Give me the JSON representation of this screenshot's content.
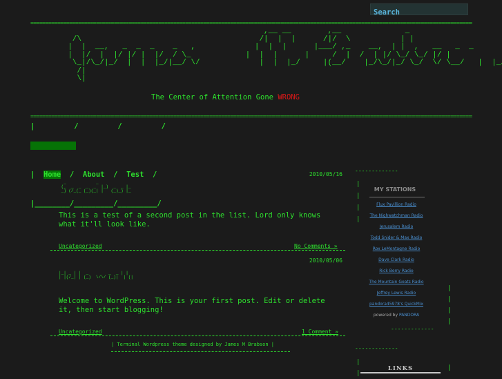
{
  "search": {
    "label": "Search"
  },
  "header": {
    "rule": "==========================================================================================================================================================",
    "logo_ascii": "                                             ,__ __        ,__              _\n   /\\                                       /|  |  |      /|/  \\           | |\n  |  |  __,   _  _  _    _   ,             |  |  |      |___/ ,_    __,  | |  ,   __   _  _\n  |  |/  |  |/ |/ |  |/  / \\_            |  |  |      |     /  |  /  | |/ \\_/ \\_/ |/ |\n   \\_|/\\_/|_/  |  |  |_/|__/ \\/             |  |  |_/     |(__/    |_/\\_/|_/ \\_/  \\/ \\__/   |  |_/\n    /|\n    \\|",
    "tagline_pre": "The Center of Attention Gone",
    "tagline_wrong": "WRONG"
  },
  "nav": {
    "row1": "|         /         /         /",
    "items": [
      "Home",
      "About",
      "Test"
    ],
    "row3": "|________/_________/_________/"
  },
  "posts": [
    {
      "date": "2010/05/16",
      "title_ascii": "  _            _\n (_  _  _  _  _  |_)  _  _ |_\n _) (/_(_ (_)(_| |   (_)_) |_",
      "body": "This is a test of a second post in the list.  Lord only knows what it'll look like.",
      "category": "Uncategorized",
      "comments": "No Comments »"
    },
    {
      "date": "2010/05/06",
      "title_ascii": "|_| _ | |  _        _  _ | |\n| |(/_| | (_)  \\/\\/ (_)|  | (|",
      "body": "Welcome to WordPress. This is your first post. Edit or delete it, then start blogging!",
      "category": "Uncategorized",
      "comments": "1 Comment »"
    }
  ],
  "footer": {
    "credit": "| Terminal Wordpress theme designed by James M Brabson |"
  },
  "sidebar": {
    "dashes": "-------------",
    "stations_title": "MY STATIONS",
    "stations": [
      "Flux Pavillion Radio",
      "The Nighwatchman Radio",
      "Jerusalem Radio",
      "Todd Snider & Max Radio",
      "Rox LeMontagne Radio",
      "Dave Clark Radio",
      "Rick Berry Radio",
      "The Mountain Goats Radio",
      "Jeffrey Lewis Radio",
      "pandora45978's QuickMix"
    ],
    "powered_pre": "powered by",
    "powered_brand": "PANDORA",
    "links_title": "LINKS"
  }
}
